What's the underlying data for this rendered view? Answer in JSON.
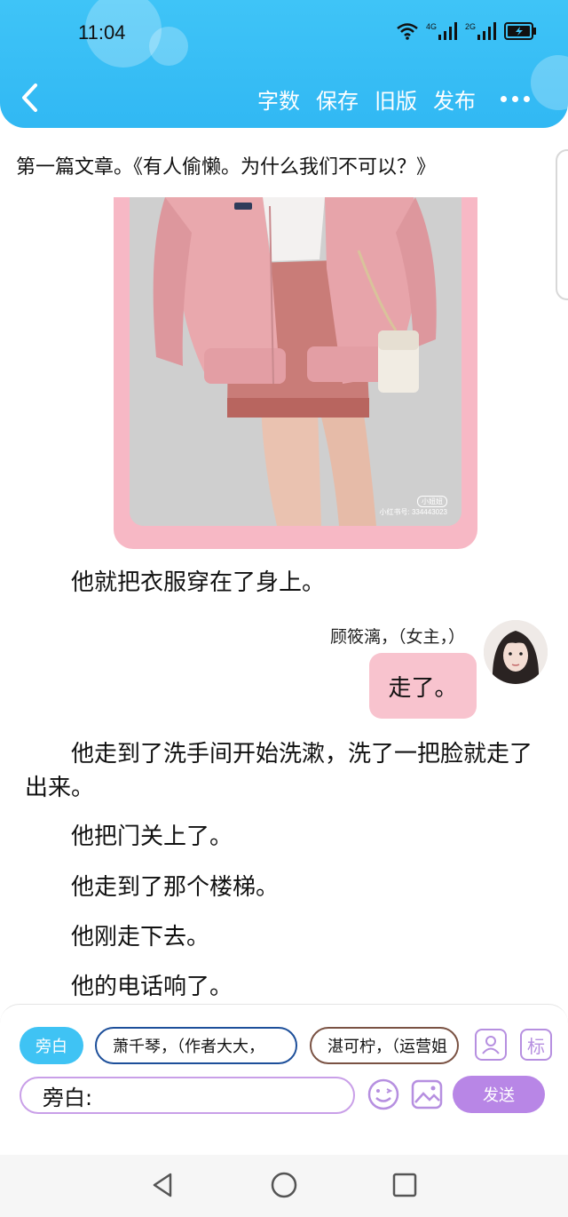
{
  "status": {
    "time": "11:04",
    "net1": "4G",
    "net2": "2G"
  },
  "toolbar": {
    "word_count": "字数",
    "save": "保存",
    "old_version": "旧版",
    "publish": "发布"
  },
  "article": {
    "title": "第一篇文章。《有人偷懒。为什么我们不可以？》",
    "photo_watermark": "小红书号: 334443023",
    "photo_badge": "小妞妞",
    "paragraphs": [
      "他就把衣服穿在了身上。",
      "他走到了洗手间开始洗漱，洗了一把脸就走了出来。",
      "他把门关上了。",
      "他走到了那个楼梯。",
      "他刚走下去。",
      "他的电话响了。"
    ],
    "speaker": "顾筱漓，（女主，）",
    "message": "走了。"
  },
  "composer": {
    "chips": [
      "旁白",
      "萧千琴，（作者大大，",
      "湛可柠，（运营姐"
    ],
    "input_label": "旁白:",
    "input_value": "",
    "role_icon_label": "标",
    "send": "发送"
  },
  "colors": {
    "header": "#3fc4f7",
    "bubble": "#f8c3ce",
    "send": "#b886e6",
    "accent_border": "#c99fe8"
  },
  "icons": [
    "back-arrow-icon",
    "wifi-icon",
    "signal-icon",
    "battery-icon",
    "more-icon",
    "character-icon",
    "tag-icon",
    "emoji-icon",
    "image-icon",
    "nav-back-icon",
    "nav-home-icon",
    "nav-recents-icon"
  ]
}
